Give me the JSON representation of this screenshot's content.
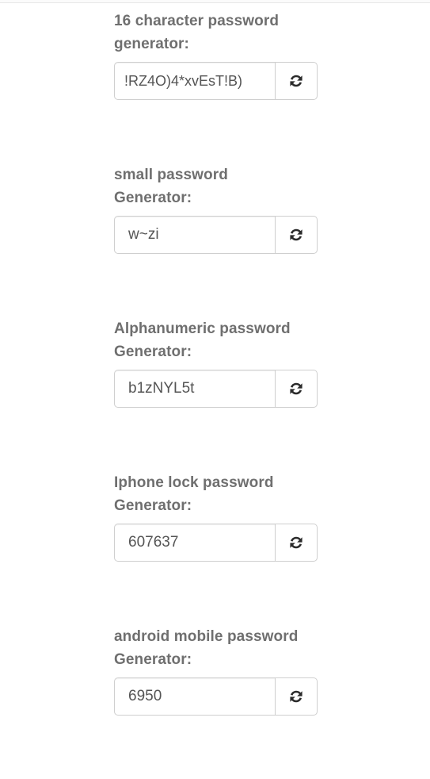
{
  "generators": [
    {
      "label": "16 character password\ngenerator:",
      "value": "!RZ4O)4*xvEsT!B)",
      "button_icon": "refresh-icon"
    },
    {
      "label": "small password\nGenerator:",
      "value": "w~zi",
      "button_icon": "refresh-icon"
    },
    {
      "label": "Alphanumeric password\nGenerator:",
      "value": "b1zNYL5t",
      "button_icon": "refresh-icon"
    },
    {
      "label": "Iphone lock password\nGenerator:",
      "value": "607637",
      "button_icon": "refresh-icon"
    },
    {
      "label": "android mobile password\nGenerator:",
      "value": "6950",
      "button_icon": "refresh-icon"
    }
  ]
}
